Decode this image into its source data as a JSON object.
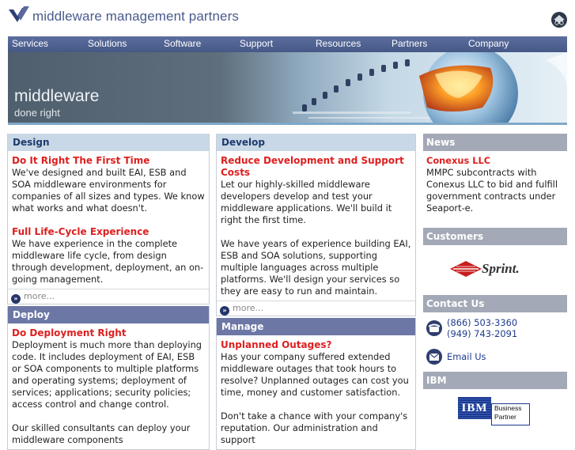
{
  "header": {
    "brand": "middleware management partners",
    "home_icon": "home-icon"
  },
  "nav": {
    "items": [
      {
        "label": "Services"
      },
      {
        "label": "Solutions"
      },
      {
        "label": "Software"
      },
      {
        "label": "Support"
      },
      {
        "label": "Resources"
      },
      {
        "label": "Partners"
      },
      {
        "label": "Company"
      }
    ]
  },
  "banner": {
    "title": "middleware",
    "subtitle": "done right"
  },
  "design": {
    "heading": "Design",
    "items": [
      {
        "title": "Do It Right The First Time",
        "text": "We've designed and built EAI, ESB and SOA middleware environments for companies of all sizes and types. We know what works and what doesn't."
      },
      {
        "title": "Full Life-Cycle Experience",
        "text": "We have experience in the complete middleware life cycle, from design through development, deployment, an on-going management."
      }
    ],
    "more": "more..."
  },
  "deploy": {
    "heading": "Deploy",
    "items": [
      {
        "title": "Do Deployment Right",
        "text": "Deployment is much more than deploying code. It includes deployment of EAI, ESB or SOA components to multiple platforms and operating systems; deployment of services; applications; security policies; access control and change control."
      }
    ],
    "trailing": "Our skilled consultants can deploy your middleware components"
  },
  "develop": {
    "heading": "Develop",
    "items": [
      {
        "title": "Reduce Development and Support Costs",
        "text": "Let our highly-skilled middleware developers develop and test your middleware applications. We'll build it right the first time."
      },
      {
        "title": "",
        "text": "We have years of experience building EAI, ESB and SOA solutions, supporting multiple languages across multiple platforms. We'll design your services so they are easy to run and maintain."
      }
    ],
    "more": "more..."
  },
  "manage": {
    "heading": "Manage",
    "items": [
      {
        "title": "Unplanned Outages?",
        "text": "Has your company suffered extended middleware outages that took hours to resolve? Unplanned outages can cost you time, money and customer satisfaction."
      },
      {
        "title": "",
        "text": "Don't take a chance with your company's reputation. Our administration and support"
      }
    ]
  },
  "news": {
    "heading": "News",
    "title": "Conexus LLC",
    "text": "MMPC subcontracts with Conexus LLC to bid and fulfill government contracts under Seaport-e."
  },
  "customers": {
    "heading": "Customers",
    "logo_text": "Sprint."
  },
  "contact": {
    "heading": "Contact Us",
    "phone1": "(866) 503-3360",
    "phone2": "(949) 743-2091",
    "email": "Email Us"
  },
  "ibm": {
    "heading": "IBM",
    "logo": "IBM",
    "badge_line1": "Business",
    "badge_line2": "Partner"
  },
  "colors": {
    "brand": "#4a5a8c",
    "nav": "#52638f",
    "accent_red": "#dd1f1f",
    "link": "#1e3a8e"
  }
}
